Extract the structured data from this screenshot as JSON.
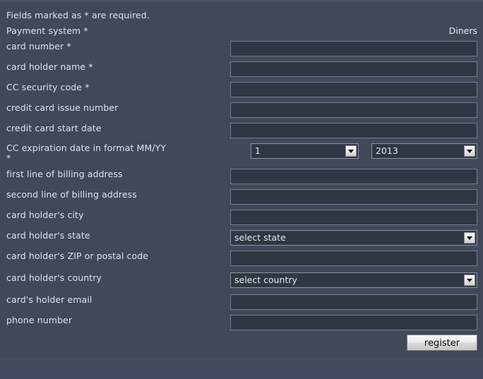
{
  "page": {
    "notice": "Fields marked as * are required.",
    "background_color": "#414858",
    "text_color": "#dfe3ea",
    "input_bg_color": "#313643",
    "input_border_color": "#737c92"
  },
  "fields": {
    "payment_system": {
      "label": "Payment system *",
      "value": "Diners"
    },
    "card_number": {
      "label": "card number *",
      "value": "",
      "placeholder": ""
    },
    "card_holder_name": {
      "label": "card holder name *",
      "value": "",
      "placeholder": ""
    },
    "cc_security_code": {
      "label": "CC security code *",
      "value": "",
      "placeholder": ""
    },
    "credit_card_issue_number": {
      "label": "credit card issue number",
      "value": "",
      "placeholder": ""
    },
    "credit_card_start_date": {
      "label": "credit card start date",
      "value": "",
      "placeholder": ""
    },
    "cc_expiration": {
      "label": "CC expiration date in format MM/YY\n*",
      "month_value": "1",
      "year_value": "2013"
    },
    "billing_address_line1": {
      "label": "first line of billing address",
      "value": "",
      "placeholder": ""
    },
    "billing_address_line2": {
      "label": "second line of billing address",
      "value": "",
      "placeholder": ""
    },
    "city": {
      "label": "card holder's city",
      "value": "",
      "placeholder": ""
    },
    "state": {
      "label": "card holder's state",
      "value": "select state"
    },
    "zip": {
      "label": "card holder's ZIP or postal code",
      "value": "",
      "placeholder": ""
    },
    "country": {
      "label": "card holder's country",
      "value": "select country"
    },
    "email": {
      "label": "card's holder email",
      "value": "",
      "placeholder": ""
    },
    "phone": {
      "label": "phone number",
      "value": "",
      "placeholder": ""
    }
  },
  "actions": {
    "register_label": "register"
  }
}
